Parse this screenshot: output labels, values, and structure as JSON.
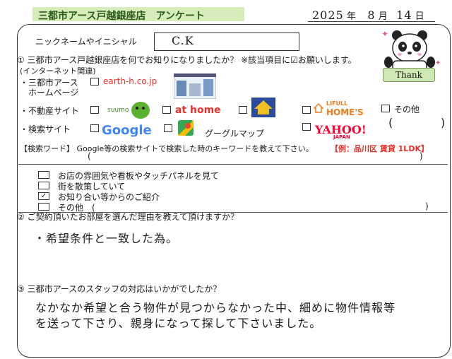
{
  "header": {
    "title": "三都市アース戸越銀座店　アンケート",
    "date_year": "2025",
    "date_year_label": "年",
    "date_month": "8",
    "date_month_label": "月",
    "date_day": "14",
    "date_day_label": "日"
  },
  "nickname": {
    "label": "ニックネームやイニシャル",
    "value": "C.K"
  },
  "thank_label": "Thank",
  "q1": {
    "text": "① 三都市アース戸越銀座店を何でお知りになりましたか？ ※該当項目に☑お願いします。",
    "internet_note": "(インターネット関連)",
    "homepage_label_1": "・三都市アース",
    "homepage_label_2": "ホームページ",
    "homepage_site": "earth-h.co.jp",
    "realestate_label": "・不動産サイト",
    "suumo": "suumo",
    "athome": "at home",
    "lifull_top": "LIFULL",
    "lifull_main": "HOME'S",
    "other_label": "その他",
    "paren_open": "(",
    "paren_close": ")",
    "search_label": "・検索サイト",
    "google": "Google",
    "google_maps": "グーグルマップ",
    "yahoo": "YAHOO!",
    "yahoo_sub": "JAPAN",
    "keyword_label": "【検索ワード】 Google等の検索サイトで検索した時のキーワードを教えて下さい。",
    "keyword_example": "【例：品川区 賃貸 1LDK】",
    "offline": [
      {
        "label": "お店の雰囲気や看板やタッチパネルを見て",
        "checked": ""
      },
      {
        "label": "街を散策していて",
        "checked": ""
      },
      {
        "label": "お知り合い等からのご紹介",
        "checked": "✓"
      },
      {
        "label": "その他　(",
        "checked": ""
      }
    ]
  },
  "q2": {
    "text": "② ご契約頂いたお部屋を選んだ理由を教えて頂けますか？",
    "answer": "・希望条件と一致した為。"
  },
  "q3": {
    "text": "③ 三都市アースのスタッフの対応はいかがでしたか？",
    "answer_line1": "なかなか希望と合う物件が見つからなかった中、細めに物件情報等",
    "answer_line2": "を送って下さり、親身になって探して下さいました。"
  },
  "colors": {
    "header_bg": "#d6ecbb",
    "red": "#e8312a",
    "google_blue": "#4285f4",
    "yahoo_red": "#ff0033"
  }
}
